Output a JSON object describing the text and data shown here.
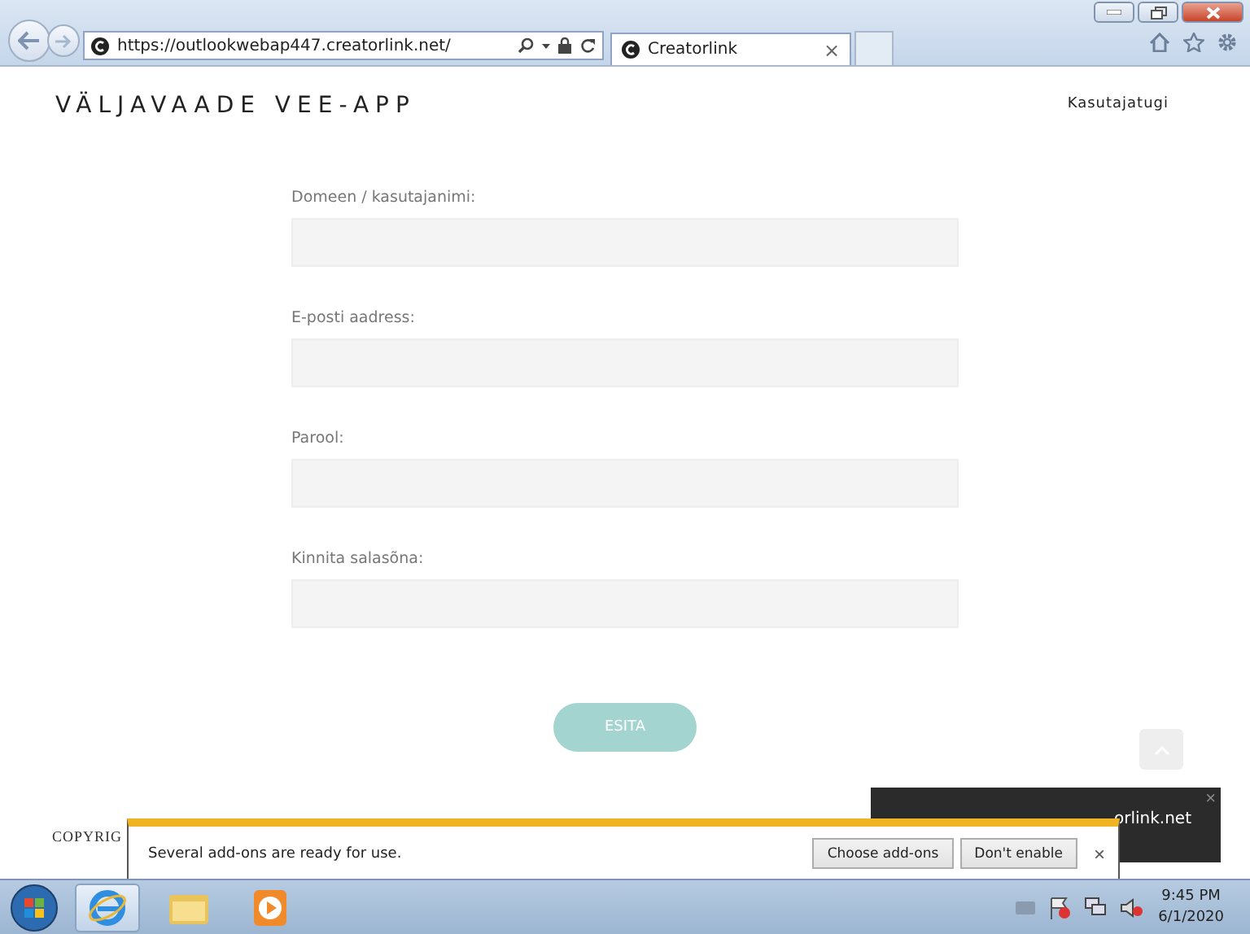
{
  "browser": {
    "url": "https://outlookwebap447.creatorlink.net/",
    "tab_title": "Creatorlink",
    "tab_close": "×"
  },
  "site": {
    "title": "VÄLJAVAADE VEE-APP",
    "nav_link": "Kasutajatugi"
  },
  "form": {
    "fields": [
      {
        "label": "Domeen / kasutajanimi:"
      },
      {
        "label": "E-posti aadress:"
      },
      {
        "label": "Parool:"
      },
      {
        "label": "Kinnita salasõna:"
      }
    ],
    "submit": "ESITA"
  },
  "footer": {
    "copyright": "COPYRIG"
  },
  "toast": {
    "text": "orlink.net",
    "close": "×"
  },
  "notification": {
    "message": "Several add-ons are ready for use.",
    "buttons": [
      "Choose add-ons",
      "Don't enable"
    ],
    "close": "×"
  },
  "taskbar": {
    "time": "9:45 PM",
    "date": "6/1/2020"
  }
}
